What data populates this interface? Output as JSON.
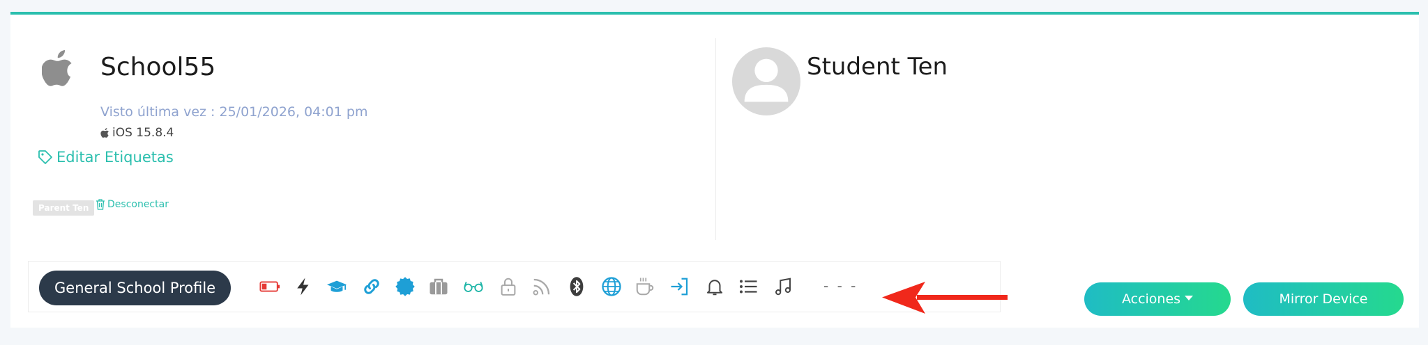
{
  "device": {
    "name": "School55",
    "last_seen": "Visto última vez : 25/01/2026, 04:01 pm",
    "os": "iOS 15.8.4",
    "edit_tags_label": "Editar Etiquetas",
    "parent_badge": "Parent Ten",
    "disconnect_label": "Desconectar",
    "os_icon": "apple-icon"
  },
  "student": {
    "name": "Student Ten",
    "avatar_icon": "user-avatar-icon"
  },
  "toolbar": {
    "profile_button": "General School Profile",
    "status_icons": [
      "battery-low-icon",
      "lightning-icon",
      "graduation-cap-icon",
      "link-icon",
      "badge-icon",
      "briefcase-icon",
      "glasses-icon",
      "lock-icon",
      "rss-icon",
      "bluetooth-icon",
      "globe-icon",
      "coffee-icon",
      "sign-in-icon",
      "bell-icon",
      "list-icon",
      "music-icon"
    ],
    "placeholder": "- - -"
  },
  "actions": {
    "acciones_label": "Acciones",
    "mirror_label": "Mirror Device"
  },
  "colors": {
    "accent": "#2bbfae",
    "dark_button": "#2c3a4a",
    "battery_red": "#e53935",
    "arrow_red": "#f0281b",
    "gradient_start": "#1fbcc4",
    "gradient_end": "#25d98e"
  }
}
